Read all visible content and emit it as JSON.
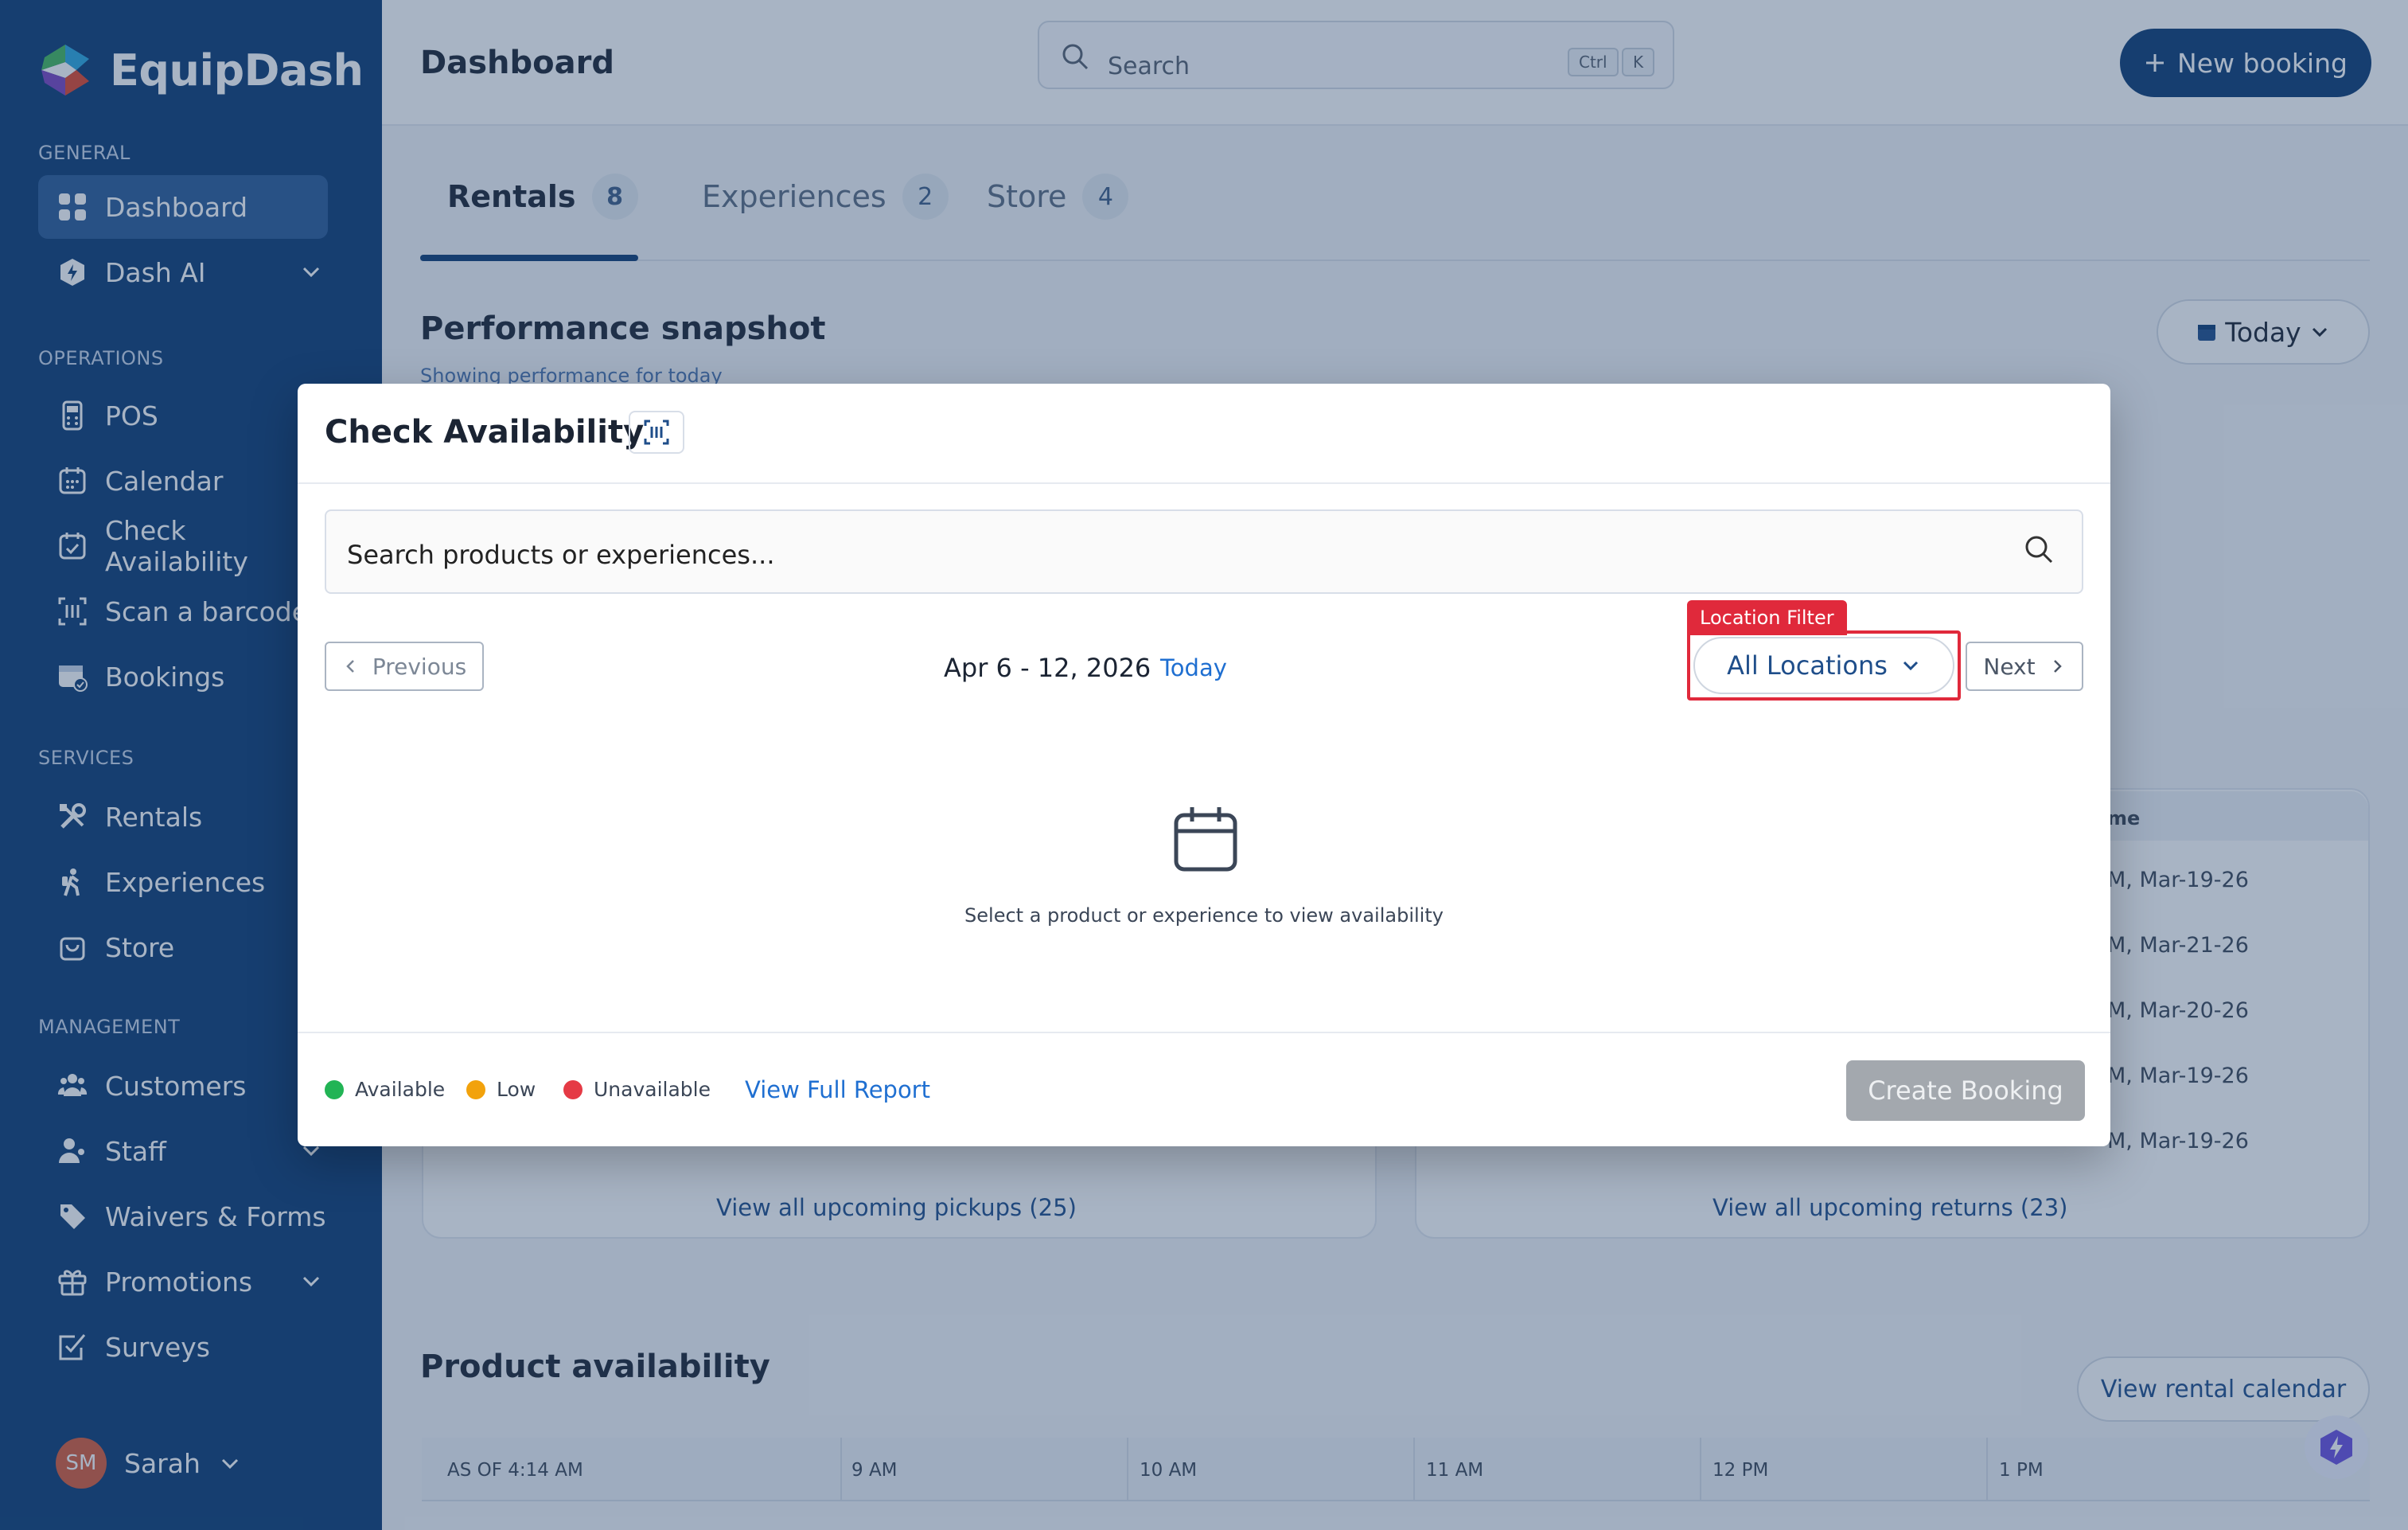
{
  "app": {
    "name": "EquipDash"
  },
  "sidebar": {
    "sections": {
      "general": "GENERAL",
      "operations": "OPERATIONS",
      "services": "SERVICES",
      "management": "MANAGEMENT"
    },
    "items": [
      {
        "label": "Dashboard"
      },
      {
        "label": "Dash AI"
      },
      {
        "label": "POS"
      },
      {
        "label": "Calendar"
      },
      {
        "label": "Check Availability"
      },
      {
        "label": "Scan a barcode"
      },
      {
        "label": "Bookings"
      },
      {
        "label": "Rentals"
      },
      {
        "label": "Experiences"
      },
      {
        "label": "Store"
      },
      {
        "label": "Customers"
      },
      {
        "label": "Staff"
      },
      {
        "label": "Waivers & Forms"
      },
      {
        "label": "Promotions"
      },
      {
        "label": "Surveys"
      }
    ],
    "user": {
      "initials": "SM",
      "name": "Sarah"
    }
  },
  "header": {
    "title": "Dashboard",
    "search_placeholder": "Search",
    "shortcut_ctrl": "Ctrl",
    "shortcut_key": "K",
    "new_booking_label": "New booking"
  },
  "tabs": [
    {
      "label": "Rentals",
      "count": "8"
    },
    {
      "label": "Experiences",
      "count": "2"
    },
    {
      "label": "Store",
      "count": "4"
    }
  ],
  "performance": {
    "title": "Performance snapshot",
    "subtitle": "Showing performance for today",
    "period": "Today"
  },
  "returns_partial": {
    "header": "me",
    "rows": [
      "M, Mar-19-26",
      "M, Mar-21-26",
      "M, Mar-20-26",
      "M, Mar-19-26",
      "M, Mar-19-26"
    ]
  },
  "links": {
    "pickups": "View all upcoming pickups (25)",
    "returns": "View all upcoming returns (23)"
  },
  "product_availability": {
    "title": "Product availability",
    "calendar_button": "View rental calendar",
    "as_of": "AS OF 4:14 AM",
    "times": [
      "9 AM",
      "10 AM",
      "11 AM",
      "12 PM",
      "1 PM"
    ]
  },
  "modal": {
    "title": "Check Availability",
    "search_placeholder": "Search products or experiences...",
    "previous_label": "Previous",
    "next_label": "Next",
    "date_range": "Apr 6 - 12, 2026",
    "today_label": "Today",
    "location_tag": "Location Filter",
    "location_label": "All Locations",
    "empty_message": "Select a product or experience to view availability",
    "legend": [
      {
        "label": "Available",
        "color": "#22b455"
      },
      {
        "label": "Low",
        "color": "#f2a20c"
      },
      {
        "label": "Unavailable",
        "color": "#e53a45"
      }
    ],
    "report_label": "View Full Report",
    "create_label": "Create Booking"
  }
}
